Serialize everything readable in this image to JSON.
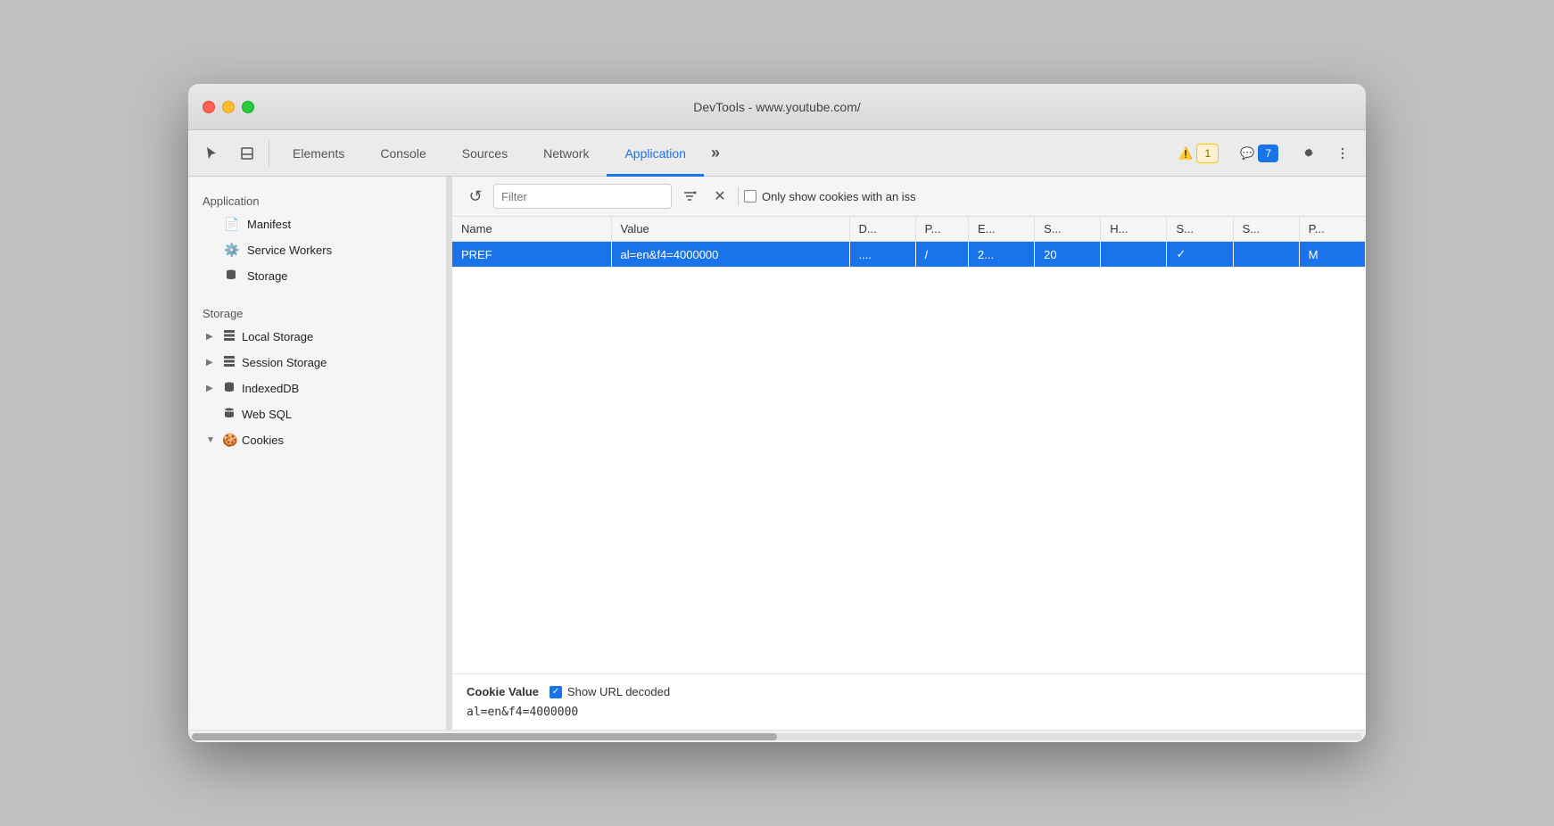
{
  "window": {
    "title": "DevTools - www.youtube.com/"
  },
  "tabs": [
    {
      "id": "elements",
      "label": "Elements",
      "active": false
    },
    {
      "id": "console",
      "label": "Console",
      "active": false
    },
    {
      "id": "sources",
      "label": "Sources",
      "active": false
    },
    {
      "id": "network",
      "label": "Network",
      "active": false
    },
    {
      "id": "application",
      "label": "Application",
      "active": true
    }
  ],
  "badges": {
    "warning": {
      "icon": "⚠️",
      "count": "1"
    },
    "info": {
      "icon": "💬",
      "count": "7"
    }
  },
  "sidebar": {
    "application_section": "Application",
    "items_app": [
      {
        "id": "manifest",
        "label": "Manifest",
        "icon": "📄"
      },
      {
        "id": "service-workers",
        "label": "Service Workers",
        "icon": "⚙️"
      },
      {
        "id": "storage",
        "label": "Storage",
        "icon": "🗄️"
      }
    ],
    "storage_section": "Storage",
    "items_storage": [
      {
        "id": "local-storage",
        "label": "Local Storage",
        "icon": "▦",
        "expandable": true,
        "expanded": false
      },
      {
        "id": "session-storage",
        "label": "Session Storage",
        "icon": "▦",
        "expandable": true,
        "expanded": false
      },
      {
        "id": "indexeddb",
        "label": "IndexedDB",
        "icon": "🗄️",
        "expandable": true,
        "expanded": false
      },
      {
        "id": "web-sql",
        "label": "Web SQL",
        "icon": "🗄️",
        "expandable": false
      },
      {
        "id": "cookies",
        "label": "Cookies",
        "icon": "🍪",
        "expandable": true,
        "expanded": true
      }
    ]
  },
  "toolbar": {
    "filter_placeholder": "Filter",
    "only_show_label": "Only show cookies with an iss",
    "refresh_icon": "↺",
    "clear_icon": "≡",
    "close_icon": "✕"
  },
  "table": {
    "columns": [
      {
        "id": "name",
        "label": "Name"
      },
      {
        "id": "value",
        "label": "Value"
      },
      {
        "id": "domain",
        "label": "D..."
      },
      {
        "id": "path",
        "label": "P..."
      },
      {
        "id": "expires",
        "label": "E..."
      },
      {
        "id": "size",
        "label": "S..."
      },
      {
        "id": "http",
        "label": "H..."
      },
      {
        "id": "secure",
        "label": "S..."
      },
      {
        "id": "samesite",
        "label": "S..."
      },
      {
        "id": "priority",
        "label": "P..."
      }
    ],
    "rows": [
      {
        "selected": true,
        "name": "PREF",
        "value": "al=en&f4=4000000",
        "domain": "....",
        "path": "/",
        "expires": "2...",
        "size": "20",
        "http": "",
        "secure": "✓",
        "samesite": "",
        "priority": "M"
      }
    ]
  },
  "cookie_value_panel": {
    "label": "Cookie Value",
    "url_decoded_label": "Show URL decoded",
    "value": "al=en&f4=4000000",
    "checked": true
  }
}
